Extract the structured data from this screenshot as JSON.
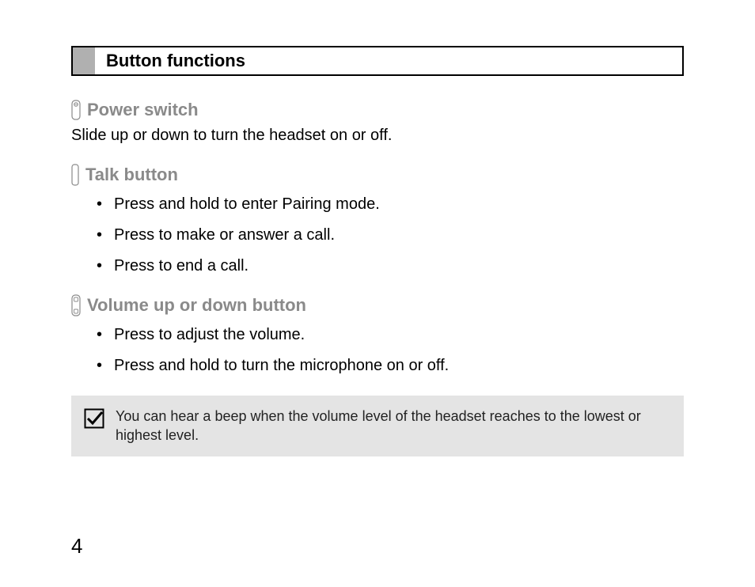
{
  "section_title": "Button functions",
  "power_switch": {
    "heading": "Power switch",
    "description": "Slide up or down to turn the headset on or off."
  },
  "talk_button": {
    "heading": "Talk button",
    "items": [
      "Press and hold to enter Pairing mode.",
      "Press to make or answer a call.",
      "Press to end a call."
    ]
  },
  "volume_button": {
    "heading": "Volume up or down button",
    "items": [
      "Press to adjust the volume.",
      "Press and hold to turn the microphone on or off."
    ]
  },
  "note": "You can hear a beep when the volume level of the headset reaches to the lowest or highest level.",
  "page_number": "4"
}
